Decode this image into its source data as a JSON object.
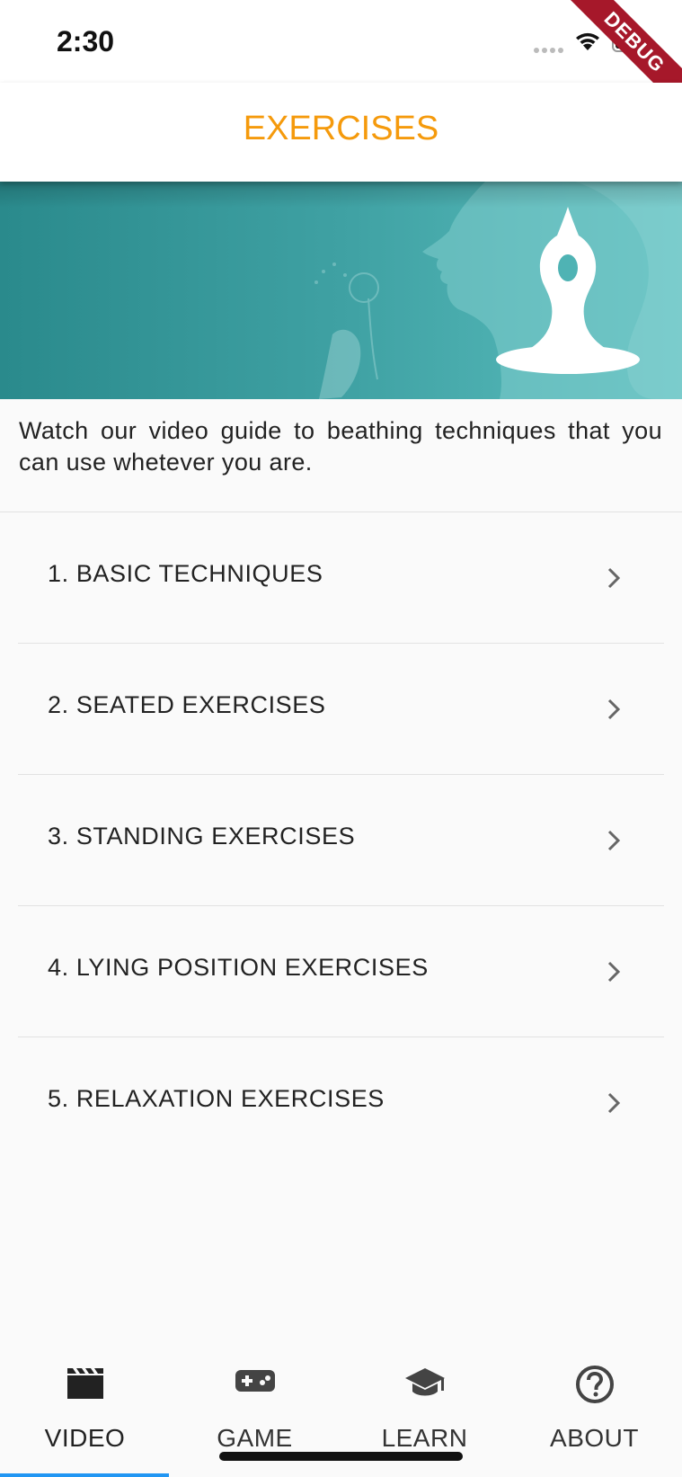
{
  "status_bar": {
    "time": "2:30"
  },
  "debug_banner": {
    "label": "DEBUG"
  },
  "app_bar": {
    "title": "EXERCISES"
  },
  "intro": {
    "text": "Watch our video guide to beathing techniques that you can use whetever you are."
  },
  "exercises": [
    {
      "label": "1. BASIC TECHNIQUES"
    },
    {
      "label": "2. SEATED EXERCISES"
    },
    {
      "label": "3. STANDING EXERCISES"
    },
    {
      "label": "4. LYING POSITION EXERCISES"
    },
    {
      "label": "5. RELAXATION EXERCISES"
    }
  ],
  "bottom_nav": {
    "tabs": [
      {
        "label": "VIDEO",
        "icon": "movie-clapper-icon",
        "active": true
      },
      {
        "label": "GAME",
        "icon": "gamepad-icon",
        "active": false
      },
      {
        "label": "LEARN",
        "icon": "graduation-cap-icon",
        "active": false
      },
      {
        "label": "ABOUT",
        "icon": "help-circle-icon",
        "active": false
      }
    ]
  },
  "colors": {
    "title": "#f59a0c",
    "banner_dark": "#2a8a8c",
    "banner_light": "#5bbfbf",
    "active_indicator": "#2196f3"
  }
}
